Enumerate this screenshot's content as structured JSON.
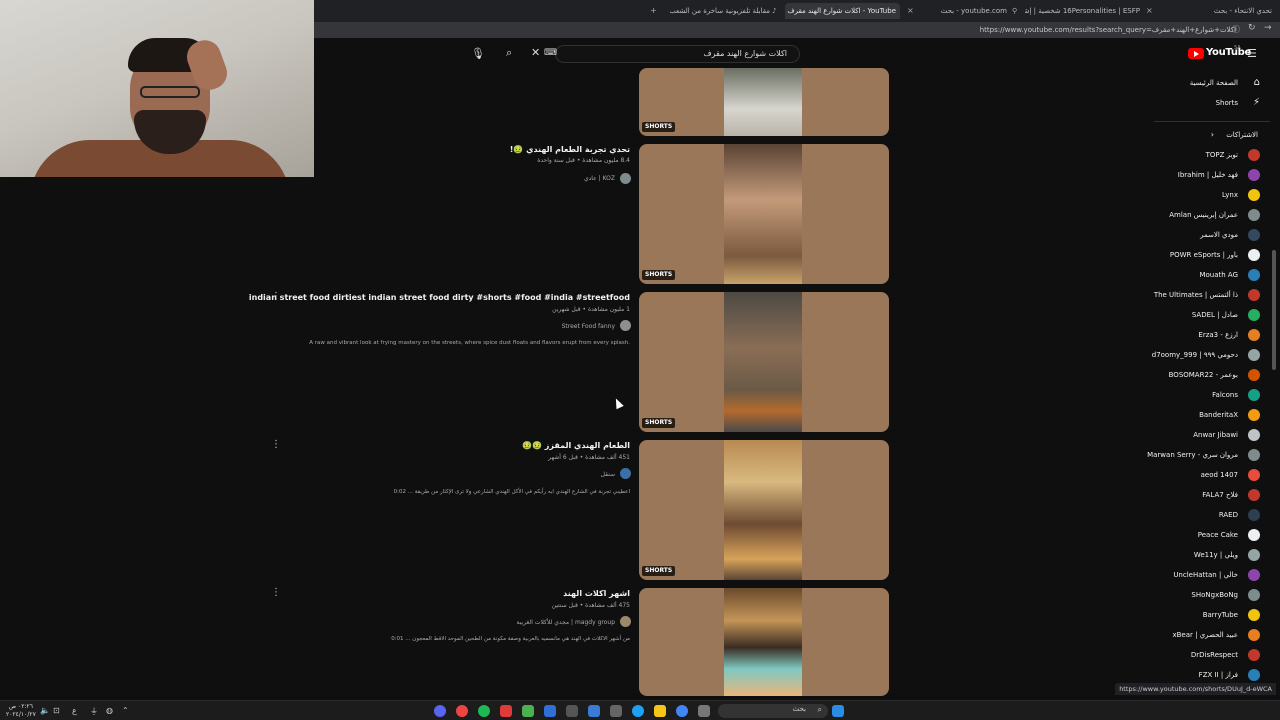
{
  "browser": {
    "tabs": [
      {
        "label": "تحدي الانتحاء - بحث",
        "active": false
      },
      {
        "label": "16Personalities | ESFP شخصية | إشتوا",
        "active": false
      },
      {
        "label": "youtube.com - بحث",
        "active": false
      },
      {
        "label": "YouTube - اكلات شوارع الهند مقرف",
        "active": true
      },
      {
        "label": "مقابلة تلفزيونية ساخرة من الشعب الـ",
        "active": false
      }
    ],
    "new_tab": "+",
    "url": "https://www.youtube.com/results?search_query=اكلات+شوارع+الهند+مقرف"
  },
  "masthead": {
    "logo_text": "YouTube",
    "logo_region": "SA",
    "search_query": "اكلات شوارع الهند مقرف"
  },
  "results": [
    {
      "title": "",
      "badge": "SHORTS",
      "meta": "",
      "channel": "",
      "description": ""
    },
    {
      "title": "تحدي تجربة الطعام الهندي 🤢!",
      "badge": "SHORTS",
      "meta": "8.4 مليون مشاهدة • قبل سنة واحدة",
      "channel": "عادي | KOZ",
      "description": ""
    },
    {
      "title": "indian street food dirtiest indian street food dirty #shorts #food #india #streetfood",
      "badge": "SHORTS",
      "meta": "1 مليون مشاهدة • قبل شهرين",
      "channel": "Street Food fanny",
      "description": "A raw and vibrant look at frying mastery on the streets, where spice dust floats and flavors erupt from every splash."
    },
    {
      "title": "الطعام الهندي المقزز 🤢🤢",
      "badge": "SHORTS",
      "meta": "451 ألف مشاهدة • قبل 6 أشهر",
      "channel": "سنقل",
      "description": "اعطيني تجربة في الشارع الهندي ايه رأيكم في الأكل الهندي الشارعي ولا ترى الإكثار من طريقة ... 0:02",
      "timestamp": "0:02"
    },
    {
      "title": "اشهر اكلات الهند",
      "badge": "SHORTS",
      "meta": "475 ألف مشاهدة • قبل سنتين",
      "channel": "مجدي للأكلات الغريبة | magdy group",
      "description": "من أشهر الاكلات في الهند هي مانسميه بالعربية وصفة مكونة من الطحين الموحد الاقط المعجون ... 0:01",
      "timestamp": "0:01"
    }
  ],
  "sidebar": {
    "home": "الصفحة الرئيسية",
    "shorts": "Shorts",
    "subscriptions_header": "الاشتراكات",
    "subscriptions": [
      {
        "name": "TOPZ توبز",
        "color": "#c0392b",
        "dot": false
      },
      {
        "name": "Ibrahim | فهد خليل",
        "color": "#8e44ad",
        "dot": true
      },
      {
        "name": "Lynx",
        "color": "#f1c40f",
        "dot": false
      },
      {
        "name": "Amlan عمران إبرينيس",
        "color": "#7f8c8d",
        "dot": true
      },
      {
        "name": "مودي الاسمر",
        "color": "#34495e",
        "dot": false
      },
      {
        "name": "POWR eSports | باور",
        "color": "#ecf0f1",
        "dot": false
      },
      {
        "name": "Mouath AG",
        "color": "#2980b9",
        "dot": false
      },
      {
        "name": "The Ultimates | ذا ألتمتس",
        "color": "#c0392b",
        "dot": false
      },
      {
        "name": "SADEL | صادل",
        "color": "#27ae60",
        "dot": true
      },
      {
        "name": "Erza3 - ارزع",
        "color": "#e67e22",
        "dot": false
      },
      {
        "name": "d7oomy_999 | دحومي ٩٩٩",
        "color": "#95a5a6",
        "dot": false
      },
      {
        "name": "BOSOMAR22 - بوعمر",
        "color": "#d35400",
        "dot": true
      },
      {
        "name": "Falcons",
        "color": "#16a085",
        "dot": false
      },
      {
        "name": "BanderitaX",
        "color": "#f39c12",
        "dot": false
      },
      {
        "name": "Anwar Jibawi",
        "color": "#bdc3c7",
        "dot": false
      },
      {
        "name": "Marwan Serry - مروان سري",
        "color": "#7f8c8d",
        "dot": true
      },
      {
        "name": "aeod 1407",
        "color": "#e74c3c",
        "dot": false
      },
      {
        "name": "FALA7 فلاح",
        "color": "#c0392b",
        "dot": false
      },
      {
        "name": "RAED",
        "color": "#2c3e50",
        "dot": false
      },
      {
        "name": "Peace Cake",
        "color": "#ecf0f1",
        "dot": false
      },
      {
        "name": "We11y | ويلي",
        "color": "#95a5a6",
        "dot": true
      },
      {
        "name": "UncleHattan | خالي",
        "color": "#8e44ad",
        "dot": false
      },
      {
        "name": "SHoNgxBoNg",
        "color": "#7f8c8d",
        "dot": false
      },
      {
        "name": "BarryTube",
        "color": "#f1c40f",
        "dot": false
      },
      {
        "name": "xBear | عبيد الحصري",
        "color": "#e67e22",
        "dot": true
      },
      {
        "name": "DrDisRespect",
        "color": "#c0392b",
        "dot": false
      },
      {
        "name": "FZX II | فراز",
        "color": "#2980b9",
        "dot": false
      }
    ]
  },
  "status_link": "https://www.youtube.com/shorts/DUuJ_d-eWCA",
  "taskbar": {
    "search_label": "بحث",
    "time": "٠٢:٢٦ ص",
    "date": "٢٠٢٤/١٠/٢٧"
  },
  "colors": {
    "background": "#0f0f0f",
    "brand_red": "#ff0000",
    "timestamp_bg": "#1b4f8a"
  }
}
